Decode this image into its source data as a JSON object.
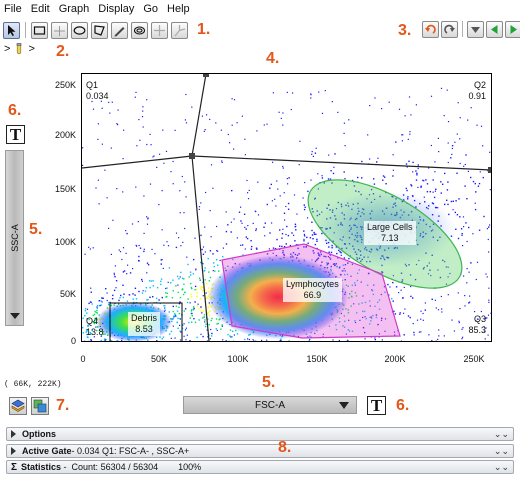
{
  "menu": [
    "File",
    "Edit",
    "Graph",
    "Display",
    "Go",
    "Help"
  ],
  "toolbar_icons": [
    "pointer-icon",
    "rectangle-gate-icon",
    "line-gate-icon",
    "ellipse-gate-icon",
    "polygon-gate-icon",
    "freehand-gate-icon",
    "spider-gate-icon",
    "quadrant-gate-icon",
    "curly-quad-icon"
  ],
  "callouts": {
    "c1": "1.",
    "c2": "2.",
    "c3": "3.",
    "c4": "4.",
    "c5a": "5.",
    "c5b": "5.",
    "c6a": "6.",
    "c6b": "6.",
    "c7": "7.",
    "c8": "8."
  },
  "breadcrumb": {
    "sep1": ">",
    "sep2": ">"
  },
  "plot": {
    "y_axis_label": "SSC-A",
    "x_axis_label": "FSC-A",
    "y_ticks": [
      "250K",
      "200K",
      "150K",
      "100K",
      "50K",
      "0"
    ],
    "x_ticks": [
      "0",
      "50K",
      "100K",
      "150K",
      "200K",
      "250K"
    ],
    "coord_readout": "( 66K, 222K)",
    "text_button": "T",
    "quadrants": [
      {
        "name": "Q1",
        "value": "0.034"
      },
      {
        "name": "Q2",
        "value": "0.91"
      },
      {
        "name": "Q3",
        "value": "85.3"
      },
      {
        "name": "Q4",
        "value": "13.8"
      }
    ],
    "gates": [
      {
        "name": "Large Cells",
        "value": "7.13",
        "color": "#5bd36b"
      },
      {
        "name": "Lymphocytes",
        "value": "66.9",
        "color": "#e04ad8"
      },
      {
        "name": "Debris",
        "value": "8.53",
        "color": "#000000"
      }
    ]
  },
  "panels": [
    {
      "title": "Options",
      "info": ""
    },
    {
      "title": "Active Gate",
      "info": " -  0.034 Q1: FSC-A- , SSC-A+"
    },
    {
      "title": "Statistics",
      "info": " -  Count: 56304 / 56304        100%"
    }
  ],
  "chart_data": {
    "type": "scatter",
    "xlabel": "FSC-A",
    "ylabel": "SSC-A",
    "xlim": [
      0,
      262144
    ],
    "ylim": [
      0,
      262144
    ],
    "x_ticks": [
      "0",
      "50K",
      "100K",
      "150K",
      "200K",
      "250K"
    ],
    "y_ticks": [
      "0",
      "50K",
      "100K",
      "150K",
      "200K",
      "250K"
    ],
    "quadrant_center": [
      70000,
      180000
    ],
    "quadrants": {
      "Q1": 0.034,
      "Q2": 0.91,
      "Q3": 85.3,
      "Q4": 13.8
    },
    "populations": [
      {
        "name": "Lymphocytes",
        "percent": 66.9,
        "center_x": 115000,
        "center_y": 42000
      },
      {
        "name": "Large Cells",
        "percent": 7.13,
        "center_x": 175000,
        "center_y": 110000
      },
      {
        "name": "Debris",
        "percent": 8.53,
        "center_x": 30000,
        "center_y": 20000
      }
    ],
    "colormap": [
      "#1a1aff",
      "#00c0ff",
      "#00e060",
      "#ffff00",
      "#ff6000",
      "#ff0000"
    ]
  }
}
